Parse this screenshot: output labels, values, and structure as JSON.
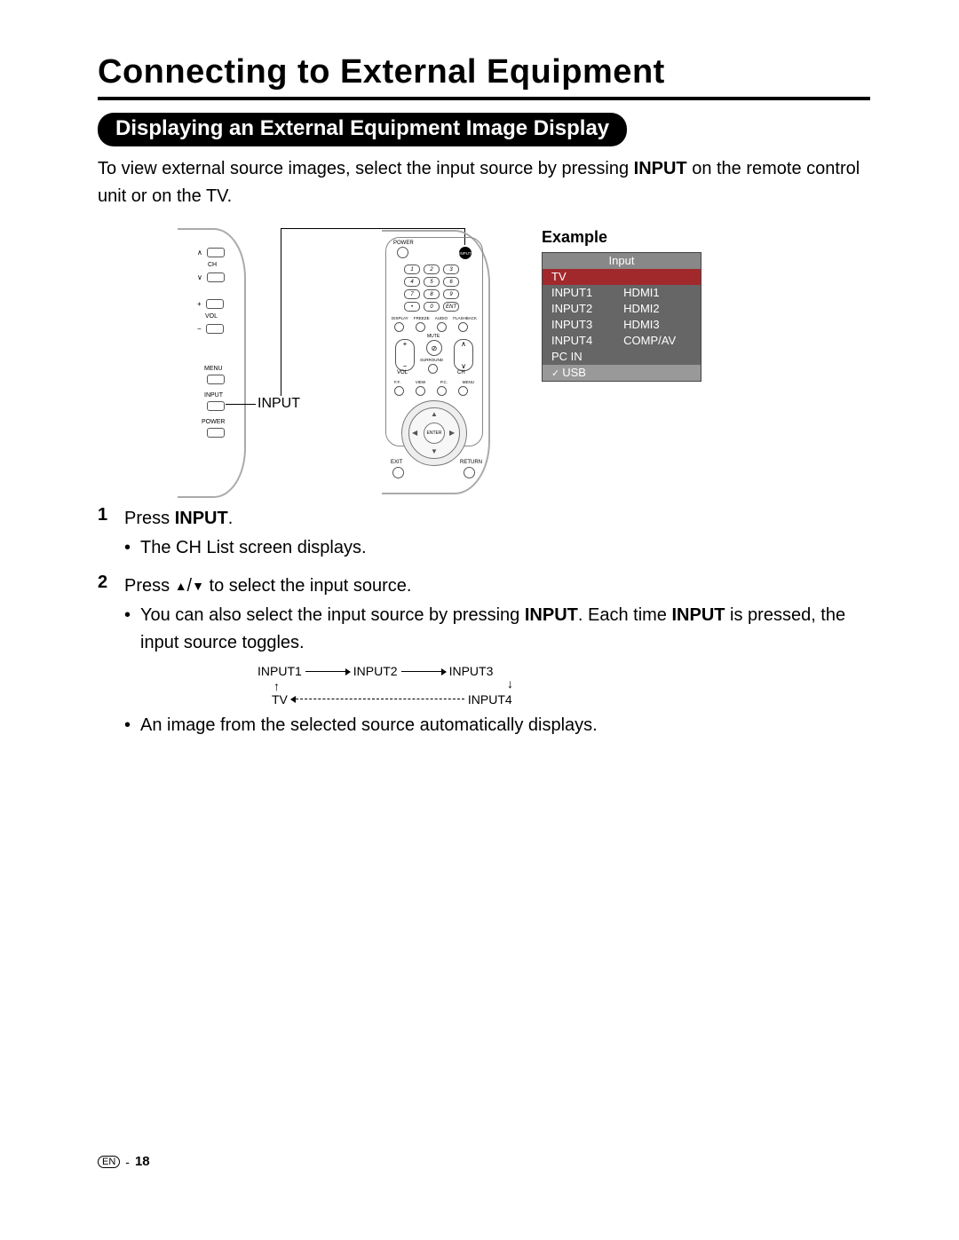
{
  "title": "Connecting to External Equipment",
  "subhead": "Displaying an External Equipment Image Display",
  "intro": {
    "prefix": "To view external source images, select the input source by pressing ",
    "bold": "INPUT",
    "suffix": " on the remote control unit or on the TV."
  },
  "tv_panel": {
    "ch": "CH",
    "vol": "VOL",
    "menu": "MENU",
    "input": "INPUT",
    "power": "POWER"
  },
  "callout_input": "INPUT",
  "remote": {
    "power": "POWER",
    "input": "INPUT",
    "keys": [
      "1",
      "2",
      "3",
      "4",
      "5",
      "6",
      "7",
      "8",
      "9",
      "•",
      "0",
      "ENT"
    ],
    "labels_row": [
      "DISPLAY",
      "FREEZE",
      "AUDIO",
      "FLASHBACK"
    ],
    "mute": "MUTE",
    "vol": "VOL",
    "ch": "CH",
    "surround": "SURROUND",
    "bottom_row": [
      "F.F.",
      "VIEW",
      "P.C.",
      "MENU"
    ],
    "enter": "ENTER",
    "exit": "EXIT",
    "return": "RETURN"
  },
  "example": {
    "title": "Example",
    "header": "Input",
    "selected": "TV",
    "rows": [
      [
        "INPUT1",
        "HDMI1"
      ],
      [
        "INPUT2",
        "HDMI2"
      ],
      [
        "INPUT3",
        "HDMI3"
      ],
      [
        "INPUT4",
        "COMP/AV"
      ]
    ],
    "pcin": "PC IN",
    "usb": "USB"
  },
  "steps": {
    "s1_prefix": "Press ",
    "s1_bold": "INPUT",
    "s1_suffix": ".",
    "s1_bullet": "The CH List screen displays.",
    "s2_prefix": "Press ",
    "s2_mid": " to select the input source.",
    "s2_b1_prefix": "You can also select the input source by pressing ",
    "s2_b1_bold1": "INPUT",
    "s2_b1_mid": ". Each time ",
    "s2_b1_bold2": "INPUT",
    "s2_b1_suffix": " is pressed, the input source toggles.",
    "s2_b2": "An image from the selected source automatically displays."
  },
  "cycle": {
    "a": "INPUT1",
    "b": "INPUT2",
    "c": "INPUT3",
    "d": "INPUT4",
    "e": "TV"
  },
  "footer": {
    "lang": "EN",
    "dash": "-",
    "page": "18"
  }
}
